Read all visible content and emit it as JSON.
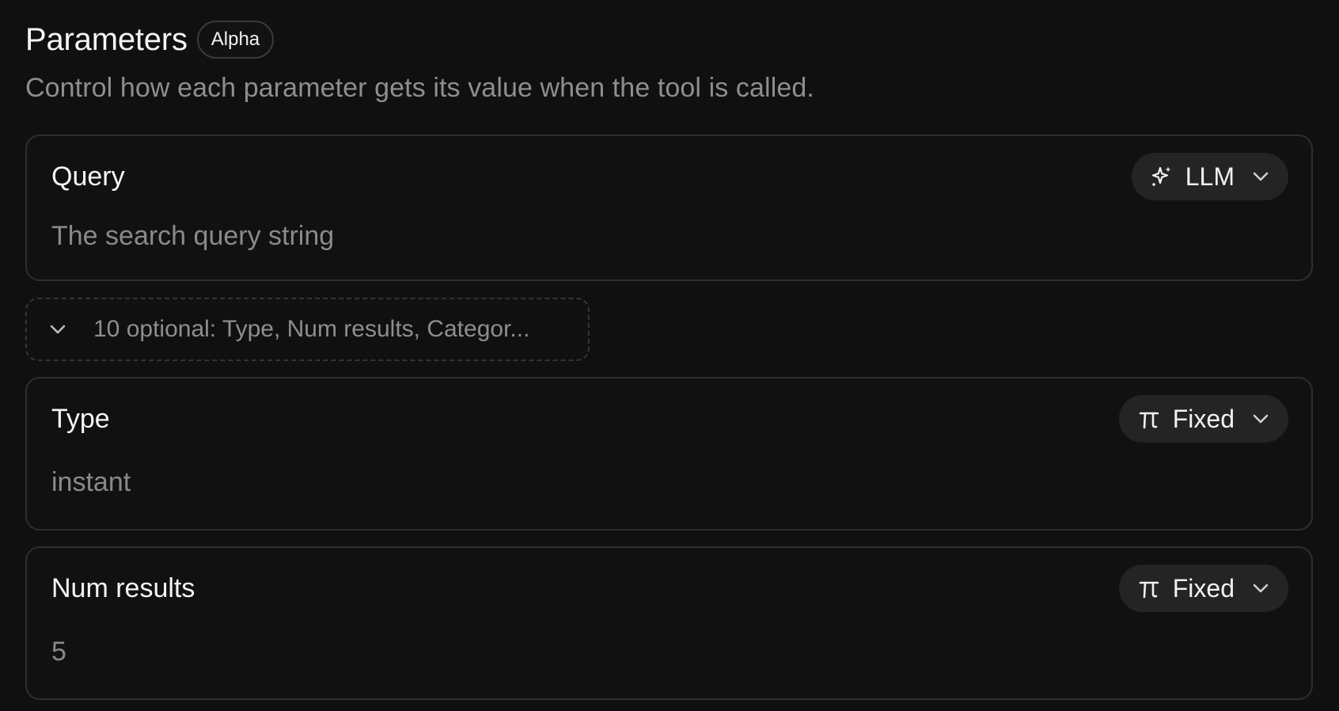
{
  "header": {
    "title": "Parameters",
    "badge": "Alpha",
    "subtitle": "Control how each parameter gets its value when the tool is called."
  },
  "parameters": [
    {
      "name": "Query",
      "value": "The search query string",
      "mode": "LLM",
      "mode_icon": "sparkle-icon"
    },
    {
      "name": "Type",
      "value": "instant",
      "mode": "Fixed",
      "mode_icon": "pi-icon"
    },
    {
      "name": "Num results",
      "value": "5",
      "mode": "Fixed",
      "mode_icon": "pi-icon"
    }
  ],
  "optional": {
    "label": "10 optional: Type, Num results, Categor..."
  },
  "colors": {
    "background": "#101010",
    "card_border": "#2e2e2e",
    "pill_background": "#242424",
    "muted_text": "#8e8e8e"
  }
}
